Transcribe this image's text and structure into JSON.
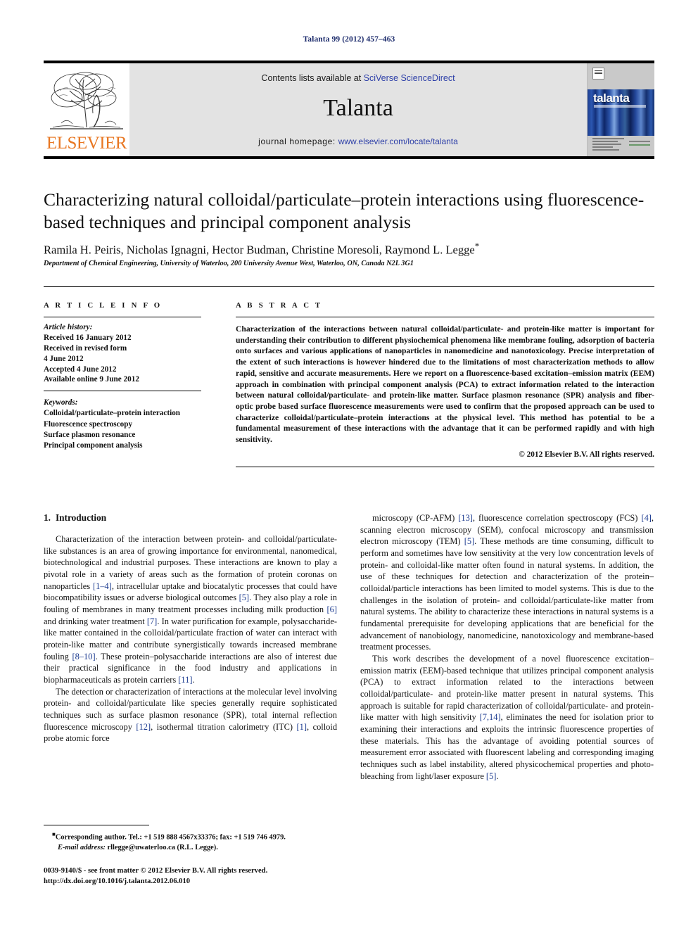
{
  "running_head": "Talanta 99 (2012) 457–463",
  "masthead": {
    "publisher_name": "ELSEVIER",
    "contents_prefix": "Contents lists available at ",
    "contents_link": "SciVerse ScienceDirect",
    "journal_name": "Talanta",
    "homepage_prefix": "journal homepage: ",
    "homepage_link": "www.elsevier.com/locate/talanta",
    "cover_title": "talanta",
    "link_color": "#2d3fa8",
    "band_color": "#e3e3e3",
    "elsevier_orange": "#E87722"
  },
  "article": {
    "title": "Characterizing natural colloidal/particulate–protein interactions using fluorescence-based techniques and principal component analysis",
    "authors": "Ramila H. Peiris, Nicholas Ignagni, Hector Budman, Christine Moresoli, Raymond L. Legge",
    "corresponding_marker": "*",
    "affiliation": "Department of Chemical Engineering, University of Waterloo, 200 University Avenue West, Waterloo, ON, Canada N2L 3G1"
  },
  "article_info": {
    "heading": "A R T I C L E   I N F O",
    "history_label": "Article history:",
    "history": [
      "Received 16 January 2012",
      "Received in revised form",
      "4 June 2012",
      "Accepted 4 June 2012",
      "Available online 9 June 2012"
    ],
    "keywords_label": "Keywords:",
    "keywords": [
      "Colloidal/particulate–protein interaction",
      "Fluorescence spectroscopy",
      "Surface plasmon resonance",
      "Principal component analysis"
    ]
  },
  "abstract": {
    "heading": "A B S T R A C T",
    "text": "Characterization of the interactions between natural colloidal/particulate- and protein-like matter is important for understanding their contribution to different physiochemical phenomena like membrane fouling, adsorption of bacteria onto surfaces and various applications of nanoparticles in nanomedicine and nanotoxicology. Precise interpretation of the extent of such interactions is however hindered due to the limitations of most characterization methods to allow rapid, sensitive and accurate measurements. Here we report on a fluorescence-based excitation–emission matrix (EEM) approach in combination with principal component analysis (PCA) to extract information related to the interaction between natural colloidal/particulate- and protein-like matter. Surface plasmon resonance (SPR) analysis and fiber-optic probe based surface fluorescence measurements were used to confirm that the proposed approach can be used to characterize colloidal/particulate–protein interactions at the physical level. This method has potential to be a fundamental measurement of these interactions with the advantage that it can be performed rapidly and with high sensitivity.",
    "copyright": "© 2012 Elsevier B.V. All rights reserved."
  },
  "body": {
    "section_number": "1.",
    "section_title": "Introduction",
    "left_paragraphs": [
      {
        "parts": [
          {
            "t": "Characterization of the interaction between protein- and colloidal/particulate-like substances is an area of growing importance for environmental, nanomedical, biotechnological and industrial purposes. These interactions are known to play a pivotal role in a variety of areas such as the formation of protein coronas on nanoparticles "
          },
          {
            "t": "[1–4]",
            "cite": true
          },
          {
            "t": ", intracellular uptake and biocatalytic processes that could have biocompatibility issues or adverse biological outcomes "
          },
          {
            "t": "[5]",
            "cite": true
          },
          {
            "t": ". They also play a role in fouling of membranes in many treatment processes including milk production "
          },
          {
            "t": "[6]",
            "cite": true
          },
          {
            "t": " and drinking water treatment "
          },
          {
            "t": "[7]",
            "cite": true
          },
          {
            "t": ". In water purification for example, polysaccharide-like matter contained in the colloidal/particulate fraction of water can interact with protein-like matter and contribute synergistically towards increased membrane fouling "
          },
          {
            "t": "[8–10]",
            "cite": true
          },
          {
            "t": ". These protein–polysaccharide interactions are also of interest due their practical significance in the food industry and applications in biopharmaceuticals as protein carriers "
          },
          {
            "t": "[11]",
            "cite": true
          },
          {
            "t": "."
          }
        ]
      },
      {
        "parts": [
          {
            "t": "The detection or characterization of interactions at the molecular level involving protein- and colloidal/particulate like species generally require sophisticated techniques such as surface plasmon resonance (SPR), total internal reflection fluorescence microscopy "
          },
          {
            "t": "[12]",
            "cite": true
          },
          {
            "t": ", isothermal titration calorimetry (ITC) "
          },
          {
            "t": "[1]",
            "cite": true
          },
          {
            "t": ", colloid probe atomic force"
          }
        ]
      }
    ],
    "right_paragraphs": [
      {
        "parts": [
          {
            "t": "microscopy (CP-AFM) "
          },
          {
            "t": "[13]",
            "cite": true
          },
          {
            "t": ", fluorescence correlation spectroscopy (FCS) "
          },
          {
            "t": "[4]",
            "cite": true
          },
          {
            "t": ", scanning electron microscopy (SEM), confocal microscopy and transmission electron microscopy (TEM) "
          },
          {
            "t": "[5]",
            "cite": true
          },
          {
            "t": ". These methods are time consuming, difficult to perform and sometimes have low sensitivity at the very low concentration levels of protein- and colloidal-like matter often found in natural systems. In addition, the use of these techniques for detection and characterization of the protein–colloidal/particle interactions has been limited to model systems. This is due to the challenges in the isolation of protein- and colloidal/particulate-like matter from natural systems. The ability to characterize these interactions in natural systems is a fundamental prerequisite for developing applications that are beneficial for the advancement of nanobiology, nanomedicine, nanotoxicology and membrane-based treatment processes."
          }
        ],
        "no_indent": false
      },
      {
        "parts": [
          {
            "t": "This work describes the development of a novel fluorescence excitation–emission matrix (EEM)-based technique that utilizes principal component analysis (PCA) to extract information related to the interactions between colloidal/particulate- and protein-like matter present in natural systems. This approach is suitable for rapid characterization of colloidal/particulate- and protein-like matter with high sensitivity "
          },
          {
            "t": "[7,14]",
            "cite": true
          },
          {
            "t": ", eliminates the need for isolation prior to examining their interactions and exploits the intrinsic fluorescence properties of these materials. This has the advantage of avoiding potential sources of measurement error associated with fluorescent labeling and corresponding imaging techniques such as label instability, altered physicochemical properties and photo-bleaching from light/laser exposure "
          },
          {
            "t": "[5]",
            "cite": true
          },
          {
            "t": "."
          }
        ]
      }
    ]
  },
  "footnotes": {
    "corresponding": "Corresponding author. Tel.: +1 519 888 4567x33376; fax: +1 519 746 4979.",
    "email_label": "E-mail address:",
    "email": "rllegge@uwaterloo.ca (R.L. Legge)."
  },
  "imprint": {
    "line1": "0039-9140/$ - see front matter © 2012 Elsevier B.V. All rights reserved.",
    "line2": "http://dx.doi.org/10.1016/j.talanta.2012.06.010"
  }
}
